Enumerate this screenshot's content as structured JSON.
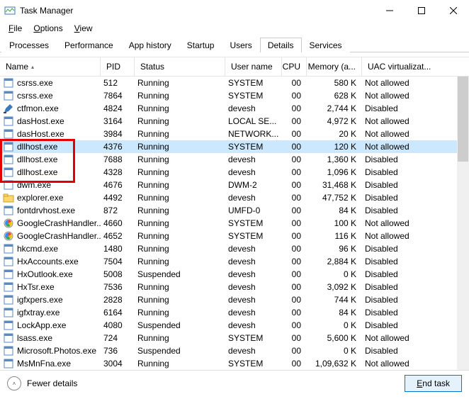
{
  "window": {
    "title": "Task Manager"
  },
  "menu": {
    "file": "File",
    "options": "Options",
    "view": "View"
  },
  "tabs": [
    "Processes",
    "Performance",
    "App history",
    "Startup",
    "Users",
    "Details",
    "Services"
  ],
  "active_tab": 5,
  "columns": {
    "name": "Name",
    "pid": "PID",
    "status": "Status",
    "user": "User name",
    "cpu": "CPU",
    "mem": "Memory (a...",
    "uac": "UAC virtualizat..."
  },
  "footer": {
    "fewer": "Fewer details",
    "endtask": "End task"
  },
  "processes": [
    {
      "icon": "app",
      "name": "csrss.exe",
      "pid": "512",
      "status": "Running",
      "user": "SYSTEM",
      "cpu": "00",
      "mem": "580 K",
      "uac": "Not allowed"
    },
    {
      "icon": "app",
      "name": "csrss.exe",
      "pid": "7864",
      "status": "Running",
      "user": "SYSTEM",
      "cpu": "00",
      "mem": "628 K",
      "uac": "Not allowed"
    },
    {
      "icon": "pen",
      "name": "ctfmon.exe",
      "pid": "4824",
      "status": "Running",
      "user": "devesh",
      "cpu": "00",
      "mem": "2,744 K",
      "uac": "Disabled"
    },
    {
      "icon": "app",
      "name": "dasHost.exe",
      "pid": "3164",
      "status": "Running",
      "user": "LOCAL SE...",
      "cpu": "00",
      "mem": "4,972 K",
      "uac": "Not allowed"
    },
    {
      "icon": "app",
      "name": "dasHost.exe",
      "pid": "3984",
      "status": "Running",
      "user": "NETWORK...",
      "cpu": "00",
      "mem": "20 K",
      "uac": "Not allowed"
    },
    {
      "icon": "app",
      "name": "dllhost.exe",
      "pid": "4376",
      "status": "Running",
      "user": "SYSTEM",
      "cpu": "00",
      "mem": "120 K",
      "uac": "Not allowed"
    },
    {
      "icon": "app",
      "name": "dllhost.exe",
      "pid": "7688",
      "status": "Running",
      "user": "devesh",
      "cpu": "00",
      "mem": "1,360 K",
      "uac": "Disabled"
    },
    {
      "icon": "app",
      "name": "dllhost.exe",
      "pid": "4328",
      "status": "Running",
      "user": "devesh",
      "cpu": "00",
      "mem": "1,096 K",
      "uac": "Disabled"
    },
    {
      "icon": "app",
      "name": "dwm.exe",
      "pid": "4676",
      "status": "Running",
      "user": "DWM-2",
      "cpu": "00",
      "mem": "31,468 K",
      "uac": "Disabled"
    },
    {
      "icon": "folder",
      "name": "explorer.exe",
      "pid": "4492",
      "status": "Running",
      "user": "devesh",
      "cpu": "00",
      "mem": "47,752 K",
      "uac": "Disabled"
    },
    {
      "icon": "app",
      "name": "fontdrvhost.exe",
      "pid": "872",
      "status": "Running",
      "user": "UMFD-0",
      "cpu": "00",
      "mem": "84 K",
      "uac": "Disabled"
    },
    {
      "icon": "google",
      "name": "GoogleCrashHandler...",
      "pid": "4660",
      "status": "Running",
      "user": "SYSTEM",
      "cpu": "00",
      "mem": "100 K",
      "uac": "Not allowed"
    },
    {
      "icon": "google",
      "name": "GoogleCrashHandler...",
      "pid": "4652",
      "status": "Running",
      "user": "SYSTEM",
      "cpu": "00",
      "mem": "116 K",
      "uac": "Not allowed"
    },
    {
      "icon": "app",
      "name": "hkcmd.exe",
      "pid": "1480",
      "status": "Running",
      "user": "devesh",
      "cpu": "00",
      "mem": "96 K",
      "uac": "Disabled"
    },
    {
      "icon": "app",
      "name": "HxAccounts.exe",
      "pid": "7504",
      "status": "Running",
      "user": "devesh",
      "cpu": "00",
      "mem": "2,884 K",
      "uac": "Disabled"
    },
    {
      "icon": "app",
      "name": "HxOutlook.exe",
      "pid": "5008",
      "status": "Suspended",
      "user": "devesh",
      "cpu": "00",
      "mem": "0 K",
      "uac": "Disabled"
    },
    {
      "icon": "app",
      "name": "HxTsr.exe",
      "pid": "7536",
      "status": "Running",
      "user": "devesh",
      "cpu": "00",
      "mem": "3,092 K",
      "uac": "Disabled"
    },
    {
      "icon": "app",
      "name": "igfxpers.exe",
      "pid": "2828",
      "status": "Running",
      "user": "devesh",
      "cpu": "00",
      "mem": "744 K",
      "uac": "Disabled"
    },
    {
      "icon": "app",
      "name": "igfxtray.exe",
      "pid": "6164",
      "status": "Running",
      "user": "devesh",
      "cpu": "00",
      "mem": "84 K",
      "uac": "Disabled"
    },
    {
      "icon": "app",
      "name": "LockApp.exe",
      "pid": "4080",
      "status": "Suspended",
      "user": "devesh",
      "cpu": "00",
      "mem": "0 K",
      "uac": "Disabled"
    },
    {
      "icon": "app",
      "name": "lsass.exe",
      "pid": "724",
      "status": "Running",
      "user": "SYSTEM",
      "cpu": "00",
      "mem": "5,600 K",
      "uac": "Not allowed"
    },
    {
      "icon": "app",
      "name": "Microsoft.Photos.exe",
      "pid": "736",
      "status": "Suspended",
      "user": "devesh",
      "cpu": "00",
      "mem": "0 K",
      "uac": "Disabled"
    },
    {
      "icon": "app",
      "name": "MsMnFna.exe",
      "pid": "3004",
      "status": "Running",
      "user": "SYSTEM",
      "cpu": "00",
      "mem": "1,09,632 K",
      "uac": "Not allowed"
    }
  ],
  "selected_row": 5,
  "redbox_rows": [
    5,
    6,
    7
  ]
}
